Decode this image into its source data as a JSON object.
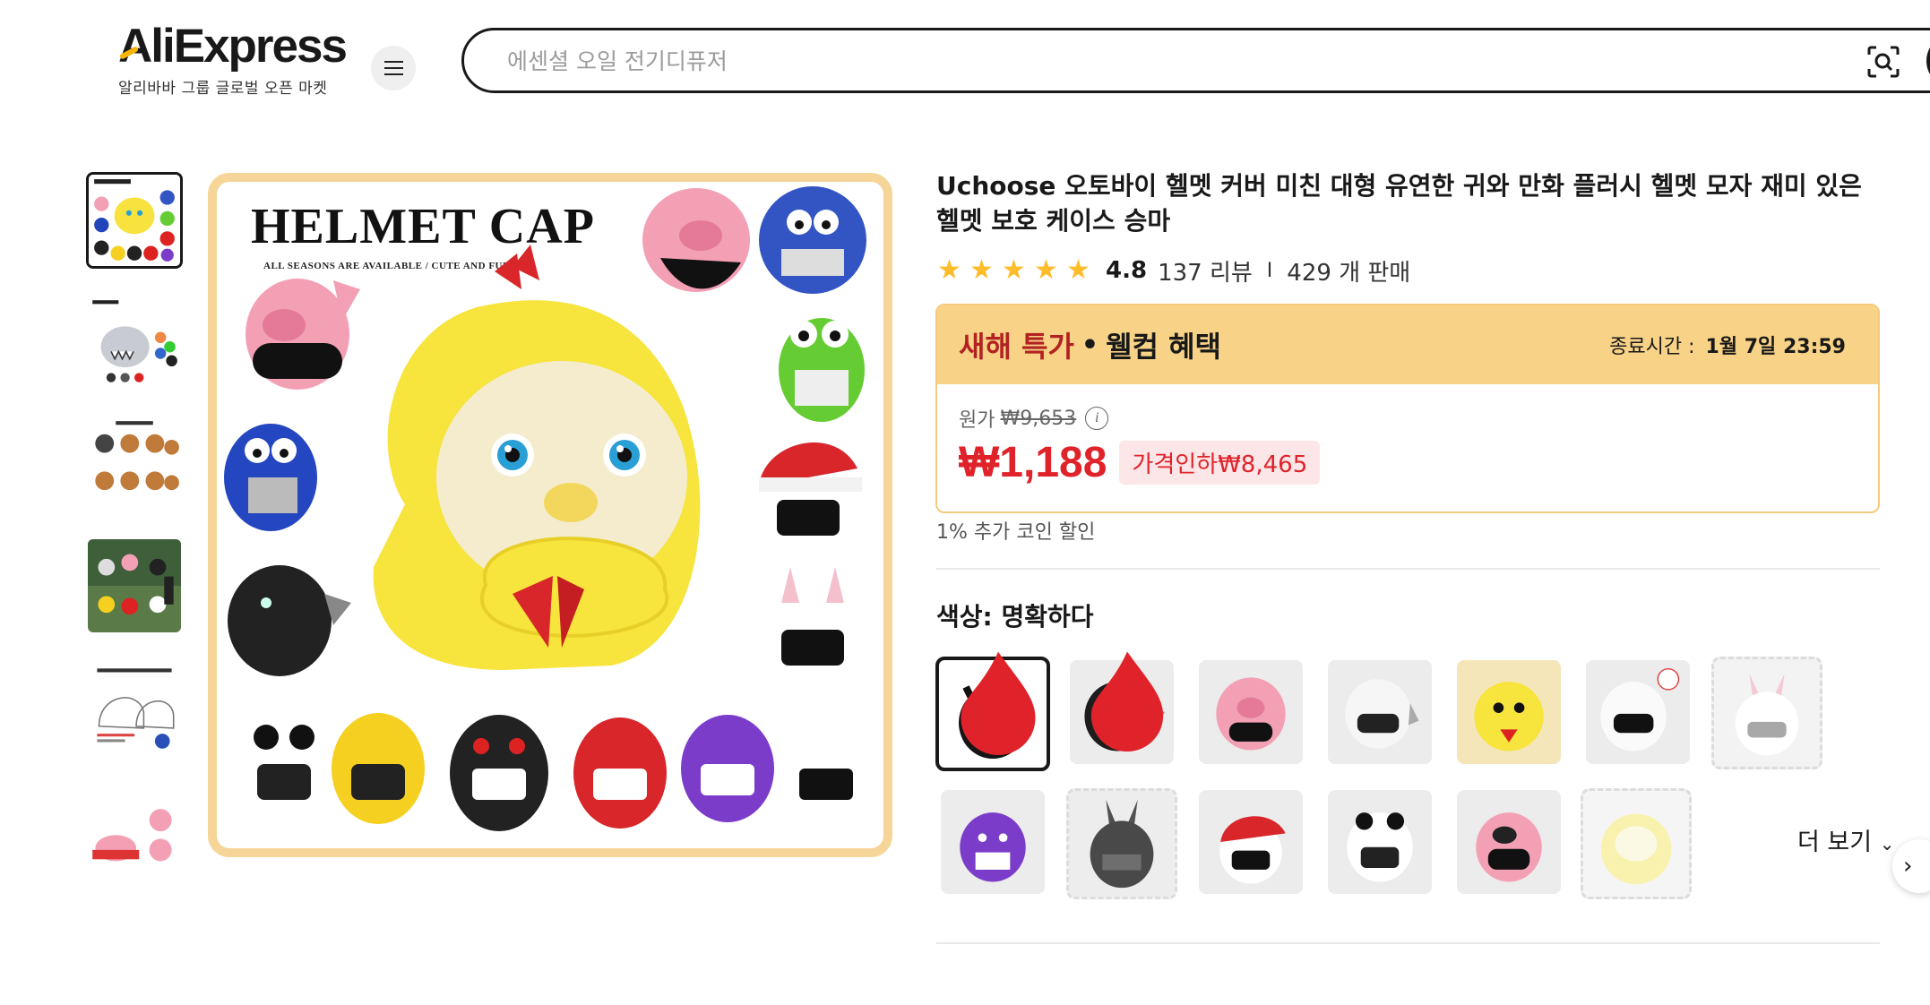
{
  "header": {
    "logo_text": "AliExpress",
    "logo_subtitle": "알리바바 그룹 글로벌 오픈 마켓",
    "search_placeholder": "에센셜 오일 전기디퓨저"
  },
  "gallery": {
    "main_image_title": "HELMET CAP",
    "main_image_subtitle": "ALL SEASONS ARE AVAILABLE   /   CUTE AND FUNNY",
    "thumbnail_count": 6,
    "active_index": 0
  },
  "product": {
    "title": "Uchoose 오토바이 헬멧 커버 미친 대형 유연한 귀와 만화 플러시 헬멧 모자 재미 있은 헬멧 보호 케이스 승마",
    "rating": "4.8",
    "reviews": "137 리뷰",
    "sold": "429 개 판매",
    "separator": "I"
  },
  "deal": {
    "name": "새해 특가",
    "dot": "•",
    "welcome": "웰컴 혜택",
    "end_label": "종료시간 :",
    "end_time": "1월 7일 23:59",
    "original_label": "원가",
    "original_price": "₩9,653",
    "price": "₩1,188",
    "discount": "가격인하₩8,465"
  },
  "coin_discount": "1% 추가 코인 할인",
  "color": {
    "label": "색상: 명확하다",
    "more_label": "더 보기",
    "options": [
      "black-devil",
      "black-dragon",
      "pink-pig",
      "white-shark",
      "yellow-chick",
      "white-unicorn",
      "white-rabbit",
      "purple-devil",
      "black-rabbit",
      "santa-hat",
      "panda",
      "pink-dog",
      "yellow-chick-light"
    ]
  },
  "colors": {
    "brand_accent": "#f7b500",
    "price_red": "#e0232b",
    "deal_bg": "#f8d387",
    "deal_border": "#f6ca7d",
    "star": "#fdbd2b"
  }
}
